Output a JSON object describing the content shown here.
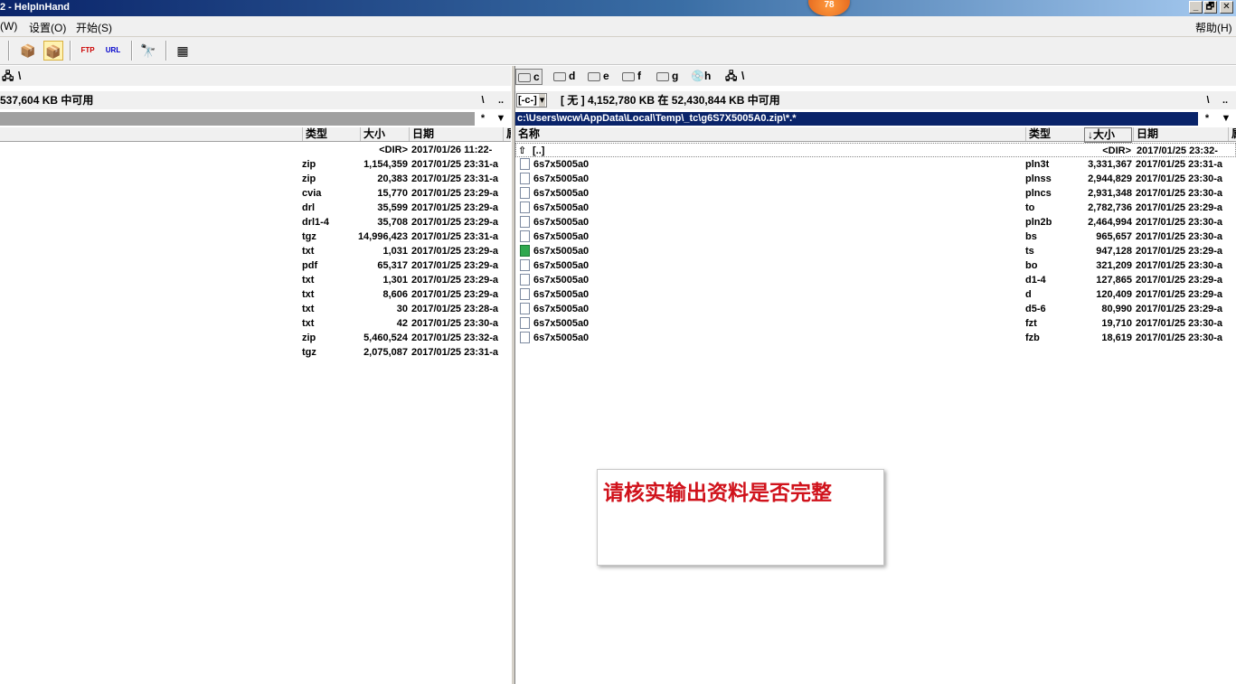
{
  "window": {
    "title": "2 - HelpInHand",
    "badge": "78"
  },
  "menu": {
    "items": [
      "(W)",
      "设置(O)",
      "开始(S)"
    ],
    "help": "帮助(H)"
  },
  "window_buttons": [
    "_",
    "🗗",
    "✕"
  ],
  "left": {
    "drive_path": "\\",
    "info": "537,604 KB 中可用",
    "info_buttons": [
      "\\",
      ".."
    ],
    "path_buttons": [
      "*",
      "▼"
    ],
    "headers": [
      "类型",
      "大小",
      "日期",
      "属"
    ],
    "rows": [
      {
        "type": "",
        "size": "<DIR>",
        "date": "2017/01/26 11:22-"
      },
      {
        "type": "zip",
        "size": "1,154,359",
        "date": "2017/01/25 23:31-a"
      },
      {
        "type": "zip",
        "size": "20,383",
        "date": "2017/01/25 23:31-a"
      },
      {
        "type": "cvia",
        "size": "15,770",
        "date": "2017/01/25 23:29-a"
      },
      {
        "type": "drl",
        "size": "35,599",
        "date": "2017/01/25 23:29-a"
      },
      {
        "type": "drl1-4",
        "size": "35,708",
        "date": "2017/01/25 23:29-a"
      },
      {
        "type": "tgz",
        "size": "14,996,423",
        "date": "2017/01/25 23:31-a"
      },
      {
        "type": "txt",
        "size": "1,031",
        "date": "2017/01/25 23:29-a"
      },
      {
        "type": "pdf",
        "size": "65,317",
        "date": "2017/01/25 23:29-a"
      },
      {
        "type": "txt",
        "size": "1,301",
        "date": "2017/01/25 23:29-a"
      },
      {
        "type": "txt",
        "size": "8,606",
        "date": "2017/01/25 23:29-a"
      },
      {
        "type": "txt",
        "size": "30",
        "date": "2017/01/25 23:28-a"
      },
      {
        "type": "txt",
        "size": "42",
        "date": "2017/01/25 23:30-a"
      },
      {
        "type": "zip",
        "size": "5,460,524",
        "date": "2017/01/25 23:32-a"
      },
      {
        "type": "tgz",
        "size": "2,075,087",
        "date": "2017/01/25 23:31-a"
      }
    ]
  },
  "right": {
    "drives": [
      {
        "label": "c",
        "active": true
      },
      {
        "label": "d",
        "active": false
      },
      {
        "label": "e",
        "active": false
      },
      {
        "label": "f",
        "active": false
      },
      {
        "label": "g",
        "active": false
      },
      {
        "label": "h",
        "active": false
      }
    ],
    "drive_path": "\\",
    "drive_select": "[-c-]",
    "info": "[ 无 ]  4,152,780 KB 在 52,430,844 KB 中可用",
    "info_buttons": [
      "\\",
      ".."
    ],
    "path": "c:\\Users\\wcw\\AppData\\Local\\Temp\\_tc\\g6S7X5005A0.zip\\*.*",
    "path_buttons": [
      "*",
      "▼"
    ],
    "headers": [
      "名称",
      "类型",
      "↓大小",
      "日期",
      "属"
    ],
    "up_row": {
      "name": "[..]",
      "size": "<DIR>",
      "date": "2017/01/25 23:32-"
    },
    "rows": [
      {
        "name": "6s7x5005a0",
        "type": "pln3t",
        "size": "3,331,367",
        "date": "2017/01/25 23:31-a"
      },
      {
        "name": "6s7x5005a0",
        "type": "plnss",
        "size": "2,944,829",
        "date": "2017/01/25 23:30-a"
      },
      {
        "name": "6s7x5005a0",
        "type": "plncs",
        "size": "2,931,348",
        "date": "2017/01/25 23:30-a"
      },
      {
        "name": "6s7x5005a0",
        "type": "to",
        "size": "2,782,736",
        "date": "2017/01/25 23:29-a"
      },
      {
        "name": "6s7x5005a0",
        "type": "pln2b",
        "size": "2,464,994",
        "date": "2017/01/25 23:30-a"
      },
      {
        "name": "6s7x5005a0",
        "type": "bs",
        "size": "965,657",
        "date": "2017/01/25 23:30-a"
      },
      {
        "name": "6s7x5005a0",
        "type": "ts",
        "size": "947,128",
        "date": "2017/01/25 23:29-a"
      },
      {
        "name": "6s7x5005a0",
        "type": "bo",
        "size": "321,209",
        "date": "2017/01/25 23:30-a"
      },
      {
        "name": "6s7x5005a0",
        "type": "d1-4",
        "size": "127,865",
        "date": "2017/01/25 23:29-a"
      },
      {
        "name": "6s7x5005a0",
        "type": "d",
        "size": "120,409",
        "date": "2017/01/25 23:29-a"
      },
      {
        "name": "6s7x5005a0",
        "type": "d5-6",
        "size": "80,990",
        "date": "2017/01/25 23:29-a"
      },
      {
        "name": "6s7x5005a0",
        "type": "fzt",
        "size": "19,710",
        "date": "2017/01/25 23:30-a"
      },
      {
        "name": "6s7x5005a0",
        "type": "fzb",
        "size": "18,619",
        "date": "2017/01/25 23:30-a"
      }
    ]
  },
  "note": {
    "text": "请核实输出资料是否完整",
    "color": "#d0121b"
  },
  "colors": {
    "title_bar": "#0a246a",
    "path_bar": "#0a246a",
    "path_text": "#ffffff"
  }
}
